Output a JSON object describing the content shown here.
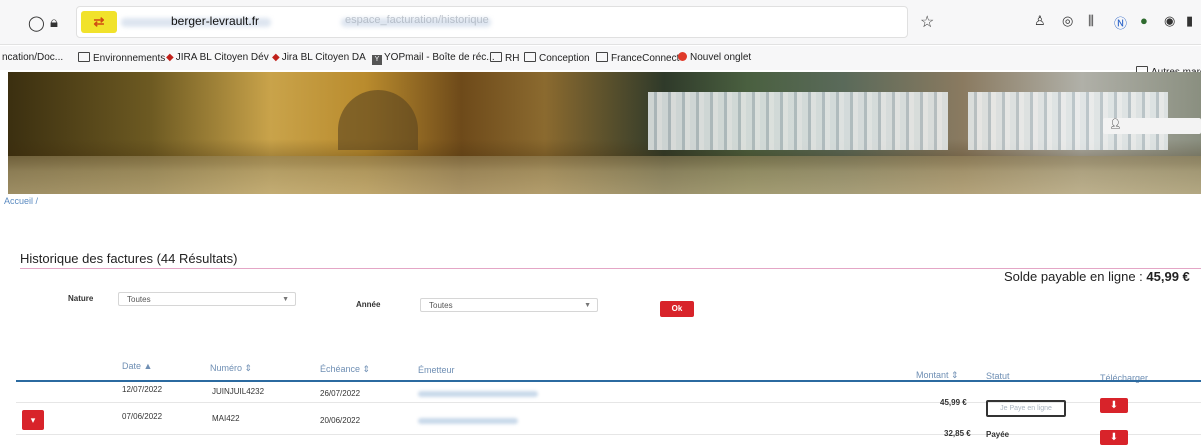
{
  "browser": {
    "address_badge": "⇄",
    "host": "berger-levrault.fr",
    "path": "espace_facturation/historique",
    "bookmarks": [
      "ncation/Doc...",
      "Environnements",
      "JIRA BL Citoyen Dév",
      "Jira BL Citoyen DA",
      "YOPmail - Boîte de réc...",
      "RH",
      "Conception",
      "FranceConnect",
      "Nouvel onglet"
    ],
    "other_bookmarks": "Autres marque"
  },
  "breadcrumb": "Accueil /",
  "page": {
    "title": "Historique des factures (44 Résultats)",
    "solde_label": "Solde payable en ligne :",
    "solde_value": "45,99 €"
  },
  "filters": {
    "nature_label": "Nature",
    "nature_value": "Toutes",
    "annee_label": "Année",
    "annee_value": "Toutes",
    "ok_label": "Ok"
  },
  "table": {
    "headers": {
      "date": "Date ▲",
      "numero": "Numéro ⇕",
      "echeance": "Échéance ⇕",
      "emetteur": "Émetteur",
      "montant": "Montant ⇕",
      "statut": "Statut",
      "telecharger": "Télécharger"
    },
    "rows": [
      {
        "date": "12/07/2022",
        "numero": "JUINJUIL4232",
        "echeance": "26/07/2022",
        "montant": "",
        "statut": ""
      },
      {
        "date": "07/06/2022",
        "numero": "MAI422",
        "echeance": "20/06/2022",
        "montant": "45,99 €",
        "statut": "Je Paye en ligne"
      },
      {
        "date": "",
        "numero": "",
        "echeance": "",
        "montant": "32,85 €",
        "statut": "Payée"
      }
    ]
  },
  "colors": {
    "accent_red": "#d8232a",
    "table_rule": "#2b6aa0",
    "title_rule": "#e4a6c6"
  }
}
